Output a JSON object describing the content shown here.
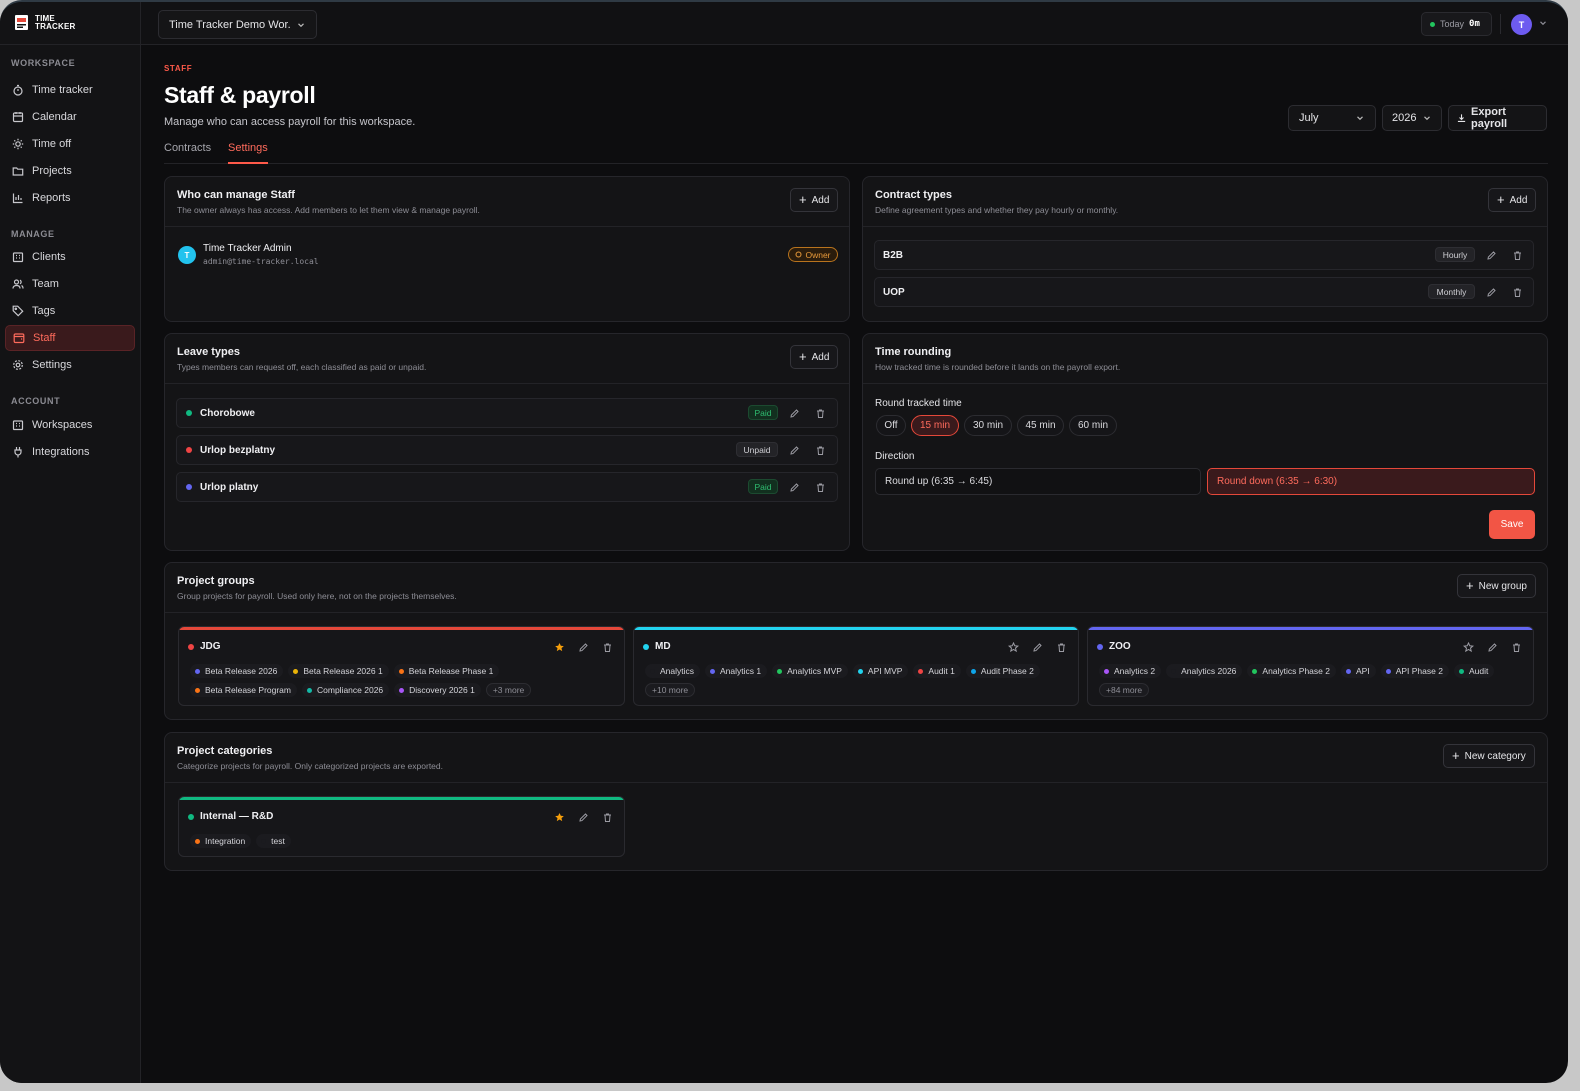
{
  "app": {
    "logo_line1": "TIME",
    "logo_line2": "TRACKER"
  },
  "sidebar": {
    "sections": [
      {
        "label": "WORKSPACE"
      },
      {
        "label": "MANAGE"
      },
      {
        "label": "ACCOUNT"
      }
    ],
    "items": [
      {
        "label": "Time tracker",
        "icon": "stopwatch-icon"
      },
      {
        "label": "Calendar",
        "icon": "calendar-icon"
      },
      {
        "label": "Time off",
        "icon": "sun-icon"
      },
      {
        "label": "Projects",
        "icon": "folder-icon"
      },
      {
        "label": "Reports",
        "icon": "bar-chart-icon"
      },
      {
        "label": "Clients",
        "icon": "building-icon"
      },
      {
        "label": "Team",
        "icon": "users-icon"
      },
      {
        "label": "Tags",
        "icon": "tag-icon"
      },
      {
        "label": "Staff",
        "icon": "wallet-icon",
        "active": true
      },
      {
        "label": "Settings",
        "icon": "gear-icon"
      },
      {
        "label": "Workspaces",
        "icon": "building-icon"
      },
      {
        "label": "Integrations",
        "icon": "plug-icon"
      }
    ]
  },
  "topbar": {
    "workspace": "Time Tracker Demo Wor...",
    "today_label": "Today",
    "today_value": "0m",
    "avatar_initial": "T"
  },
  "page": {
    "eyebrow": "STAFF",
    "title": "Staff & payroll",
    "subtitle": "Manage who can access payroll for this workspace.",
    "tabs": [
      {
        "label": "Contracts"
      },
      {
        "label": "Settings",
        "active": true
      }
    ],
    "month": "July",
    "year": "2026",
    "export_label": "Export payroll"
  },
  "managers": {
    "title": "Who can manage Staff",
    "desc": "The owner always has access. Add members to let them view & manage payroll.",
    "add_label": "Add",
    "member": {
      "initial": "T",
      "name": "Time Tracker Admin",
      "email": "admin@time-tracker.local",
      "role": "Owner"
    }
  },
  "contract_types": {
    "title": "Contract types",
    "desc": "Define agreement types and whether they pay hourly or monthly.",
    "add_label": "Add",
    "items": [
      {
        "name": "B2B",
        "kind": "Hourly"
      },
      {
        "name": "UOP",
        "kind": "Monthly"
      }
    ]
  },
  "leave_types": {
    "title": "Leave types",
    "desc": "Types members can request off, each classified as paid or unpaid.",
    "add_label": "Add",
    "items": [
      {
        "name": "Chorobowe",
        "status": "Paid",
        "color": "#10b981"
      },
      {
        "name": "Urlop bezplatny",
        "status": "Unpaid",
        "color": "#ef4444"
      },
      {
        "name": "Urlop platny",
        "status": "Paid",
        "color": "#6366f1"
      }
    ]
  },
  "rounding": {
    "title": "Time rounding",
    "desc": "How tracked time is rounded before it lands on the payroll export.",
    "round_label": "Round tracked time",
    "options": [
      {
        "label": "Off"
      },
      {
        "label": "15 min",
        "active": true
      },
      {
        "label": "30 min"
      },
      {
        "label": "45 min"
      },
      {
        "label": "60 min"
      }
    ],
    "direction_label": "Direction",
    "directions": [
      {
        "label": "Round up (6:35 → 6:45)"
      },
      {
        "label": "Round down (6:35 → 6:30)",
        "active": true
      }
    ],
    "save_label": "Save"
  },
  "project_groups": {
    "title": "Project groups",
    "desc": "Group projects for payroll. Used only here, not on the projects themselves.",
    "new_label": "New group",
    "groups": [
      {
        "name": "JDG",
        "color": "#ef4444",
        "starred": true,
        "row1": [
          {
            "label": "Beta Release 2026",
            "color": "#6366f1"
          },
          {
            "label": "Beta Release 2026 1",
            "color": "#eab308"
          },
          {
            "label": "Beta Release Phase 1",
            "color": "#f97316"
          }
        ],
        "row2": [
          {
            "label": "Beta Release Program",
            "color": "#f97316"
          },
          {
            "label": "Compliance 2026",
            "color": "#14b8a6"
          },
          {
            "label": "Discovery 2026 1",
            "color": "#a855f7"
          }
        ],
        "more": "+3 more"
      },
      {
        "name": "MD",
        "color": "#22d3ee",
        "starred": false,
        "row1": [
          {
            "label": "Analytics",
            "color": "#1b1b1f"
          },
          {
            "label": "Analytics 1",
            "color": "#6366f1"
          },
          {
            "label": "Analytics MVP",
            "color": "#22c55e"
          },
          {
            "label": "API MVP",
            "color": "#22d3ee"
          },
          {
            "label": "Audit 1",
            "color": "#ef4444"
          },
          {
            "label": "Audit Phase 2",
            "color": "#0ea5e9"
          }
        ],
        "row2": [],
        "more": "+10 more"
      },
      {
        "name": "ZOO",
        "color": "#6366f1",
        "starred": false,
        "row1": [
          {
            "label": "Analytics 2",
            "color": "#a855f7"
          },
          {
            "label": "Analytics 2026",
            "color": "#1b1b1f"
          },
          {
            "label": "Analytics Phase 2",
            "color": "#22c55e"
          },
          {
            "label": "API",
            "color": "#6366f1"
          },
          {
            "label": "API Phase 2",
            "color": "#6366f1"
          },
          {
            "label": "Audit",
            "color": "#10b981"
          }
        ],
        "row2": [],
        "more": "+84 more"
      }
    ]
  },
  "project_categories": {
    "title": "Project categories",
    "desc": "Categorize projects for payroll. Only categorized projects are exported.",
    "new_label": "New category",
    "items": [
      {
        "name": "Internal — R&D",
        "color": "#10b981",
        "starred": true,
        "chips": [
          {
            "label": "Integration",
            "color": "#f97316"
          },
          {
            "label": "test",
            "color": "#1b1b1f"
          }
        ]
      }
    ]
  }
}
